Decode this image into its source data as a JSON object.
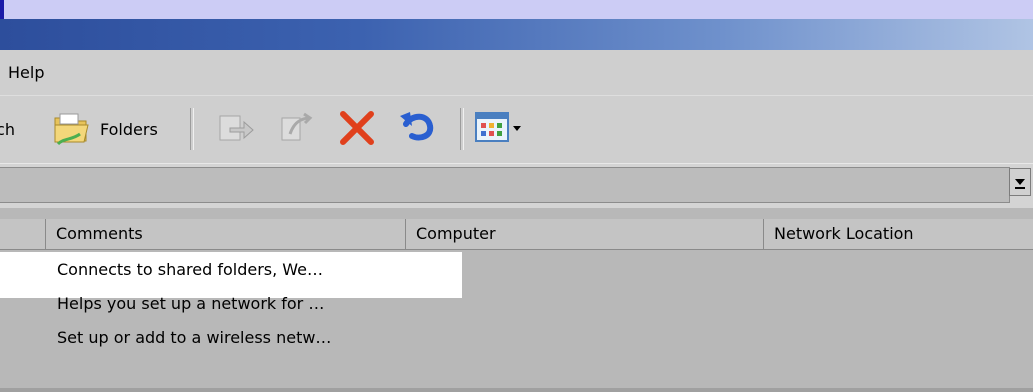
{
  "menu": {
    "items": [
      "Help"
    ]
  },
  "toolbar": {
    "search_label": "Search",
    "folders_label": "Folders"
  },
  "list": {
    "columns": [
      "Comments",
      "Computer",
      "Network Location"
    ],
    "rows": [
      {
        "comment": "Connects to shared folders, We…",
        "selected": true
      },
      {
        "comment": "Helps you set up a network for …",
        "selected": false
      },
      {
        "comment": "Set up or add to a wireless netw…",
        "selected": false
      }
    ]
  },
  "colors": {
    "title_bar_start": "#2d4e9c",
    "title_bar_end": "#b0c4e4",
    "selection": "#ffffff",
    "delete_red": "#e0401c",
    "undo_blue": "#2a5fd0"
  },
  "icons": [
    "folder-icon",
    "move-to-icon",
    "copy-to-icon",
    "delete-icon",
    "undo-icon",
    "views-icon",
    "chevron-down-icon"
  ]
}
